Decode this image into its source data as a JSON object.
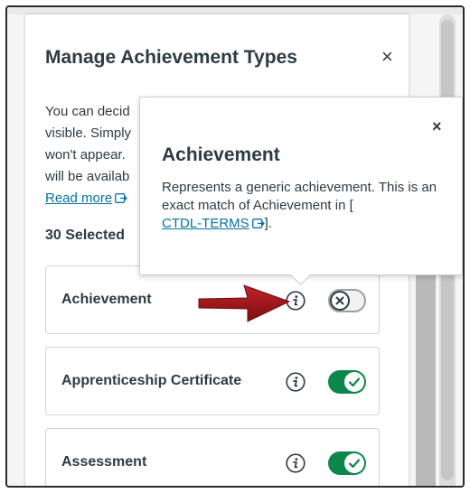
{
  "panel": {
    "title": "Manage Achievement Types",
    "close_symbol": "×",
    "description_lines": [
      "You can decid",
      "visible. Simply",
      "won't appear.",
      "will be availab"
    ],
    "read_more": "Read more",
    "selected_count": "30 Selected"
  },
  "cards": [
    {
      "label": "Achievement",
      "toggle": "off"
    },
    {
      "label": "Apprenticeship Certificate",
      "toggle": "on"
    },
    {
      "label": "Assessment",
      "toggle": "on"
    }
  ],
  "popover": {
    "close_symbol": "×",
    "title": "Achievement",
    "body_line1": "Represents a generic achievement. This is an",
    "body_line2": "exact match of Achievement in [",
    "link": "CTDL-TERMS",
    "body_end": "]."
  },
  "colors": {
    "toggle_on": "#0b874b",
    "link": "#0770a3",
    "annotation_arrow": "#a3141a"
  },
  "icons": [
    "close-icon",
    "external-link-icon",
    "info-icon",
    "x-icon",
    "checkmark-icon",
    "annotation-arrow"
  ]
}
